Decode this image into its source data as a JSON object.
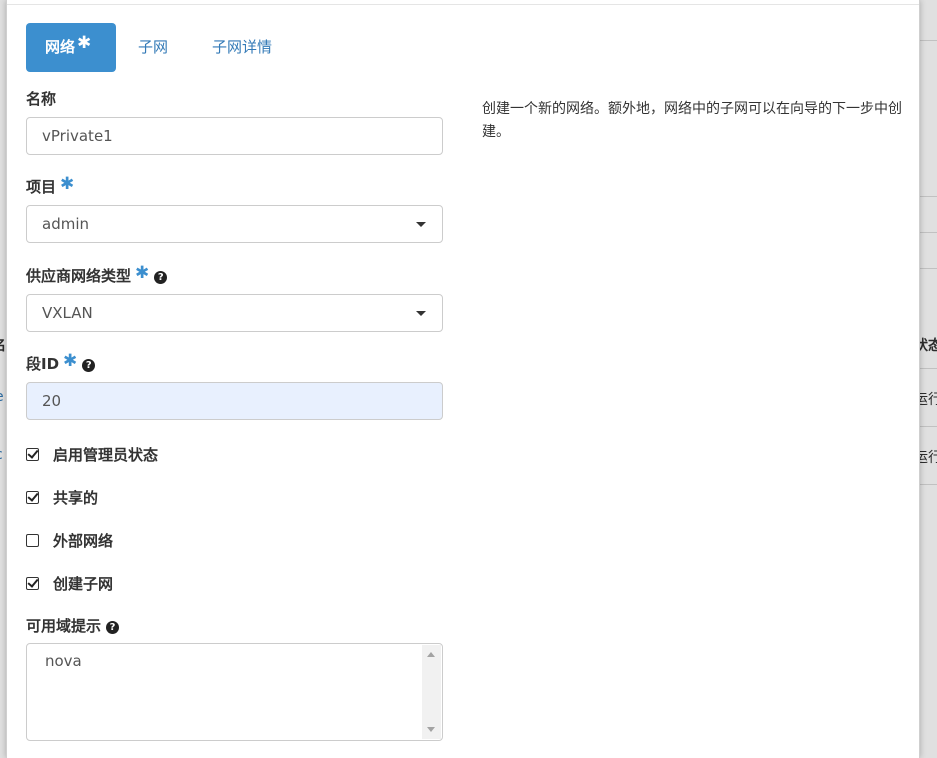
{
  "background": {
    "right_header": "状态",
    "right_rows": [
      "运行",
      "运行"
    ],
    "left_fragments": [
      "名",
      "e",
      "c"
    ]
  },
  "tabs": [
    {
      "label": "网络",
      "required_mark": "✱",
      "active": true
    },
    {
      "label": "子网",
      "active": false
    },
    {
      "label": "子网详情",
      "active": false
    }
  ],
  "form": {
    "name": {
      "label": "名称",
      "value": "vPrivate1"
    },
    "project": {
      "label": "项目",
      "required_mark": "✱",
      "value": "admin"
    },
    "provider_network_type": {
      "label": "供应商网络类型",
      "required_mark": "✱",
      "value": "VXLAN"
    },
    "segment_id": {
      "label": "段ID",
      "required_mark": "✱",
      "value": "20"
    },
    "checkboxes": [
      {
        "label": "启用管理员状态",
        "checked": true
      },
      {
        "label": "共享的",
        "checked": true
      },
      {
        "label": "外部网络",
        "checked": false
      },
      {
        "label": "创建子网",
        "checked": true
      }
    ],
    "az_hints": {
      "label": "可用域提示",
      "options": [
        "nova"
      ]
    }
  },
  "help_text": "创建一个新的网络。额外地，网络中的子网可以在向导的下一步中创建。",
  "colors": {
    "accent": "#3c8fcf",
    "link": "#337ab7",
    "autofill": "#e8f0fe"
  }
}
